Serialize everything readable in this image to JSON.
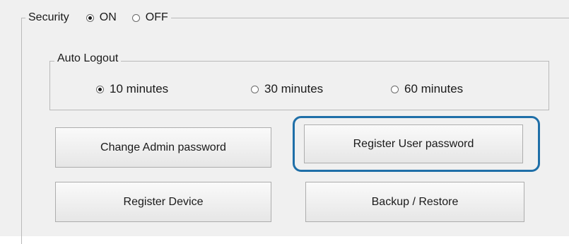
{
  "security": {
    "label": "Security",
    "on_label": "ON",
    "off_label": "OFF",
    "selected": "ON"
  },
  "auto_logout": {
    "label": "Auto Logout",
    "options": [
      "10 minutes",
      "30 minutes",
      "60 minutes"
    ],
    "selected": "10 minutes"
  },
  "buttons": {
    "change_admin": "Change Admin password",
    "register_user": "Register User password",
    "register_device": "Register Device",
    "backup_restore": "Backup / Restore"
  },
  "colors": {
    "highlight": "#1f6fa8",
    "panel_bg": "#f0f0f0"
  }
}
